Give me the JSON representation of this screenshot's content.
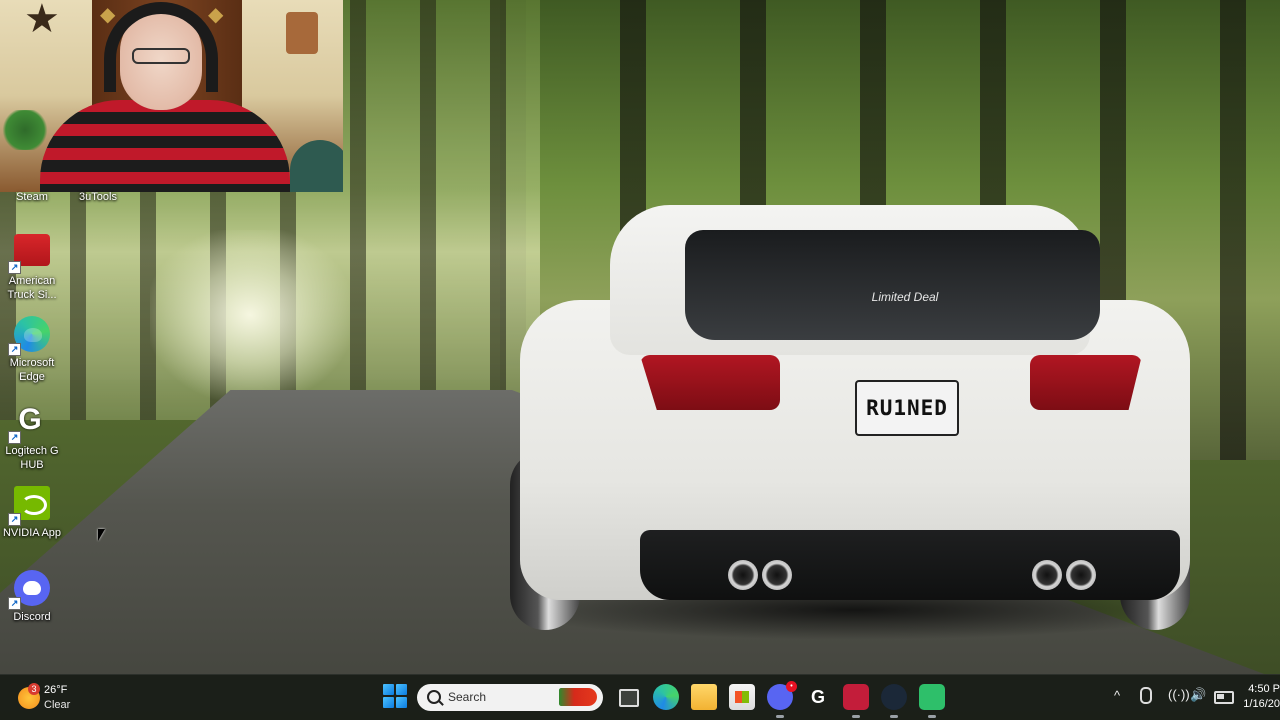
{
  "desktop": {
    "wallpaper": {
      "plate_text": "RU1NED",
      "window_sticker": "Limited Deal"
    },
    "top_icon_labels": [
      {
        "label": "Steam"
      },
      {
        "label": "3uTools"
      }
    ],
    "icons": [
      {
        "label": "American Truck Si...",
        "icon": "truck-icon"
      },
      {
        "label": "Microsoft Edge",
        "icon": "edge-icon"
      },
      {
        "label": "Logitech G HUB",
        "icon": "logitech-g-icon"
      },
      {
        "label": "NVIDIA App",
        "icon": "nvidia-icon"
      },
      {
        "label": "Discord",
        "icon": "discord-icon"
      }
    ]
  },
  "taskbar": {
    "weather": {
      "badge": "3",
      "temp": "26°F",
      "condition": "Clear"
    },
    "search": {
      "label": "Search"
    },
    "apps": [
      {
        "name": "task-view",
        "icon": "task-view-icon"
      },
      {
        "name": "edge",
        "icon": "edge-icon"
      },
      {
        "name": "file-explorer",
        "icon": "folder-icon"
      },
      {
        "name": "microsoft-store",
        "icon": "store-icon"
      },
      {
        "name": "discord",
        "icon": "discord-icon",
        "badge": "•"
      },
      {
        "name": "logitech-g-hub",
        "icon": "logitech-g-icon",
        "glyph": "G"
      },
      {
        "name": "app-red",
        "icon": "app-red-icon"
      },
      {
        "name": "steam",
        "icon": "steam-icon"
      },
      {
        "name": "obs",
        "icon": "obs-icon"
      }
    ],
    "tray": {
      "chevron": "^",
      "wifi": "((·))",
      "volume": "🔊",
      "time": "4:50 P",
      "date": "1/16/20"
    }
  },
  "colors": {
    "taskbar_bg": "#181c16",
    "accent": "#4cc2ff",
    "discord": "#5865f2",
    "nvidia": "#76b900"
  }
}
